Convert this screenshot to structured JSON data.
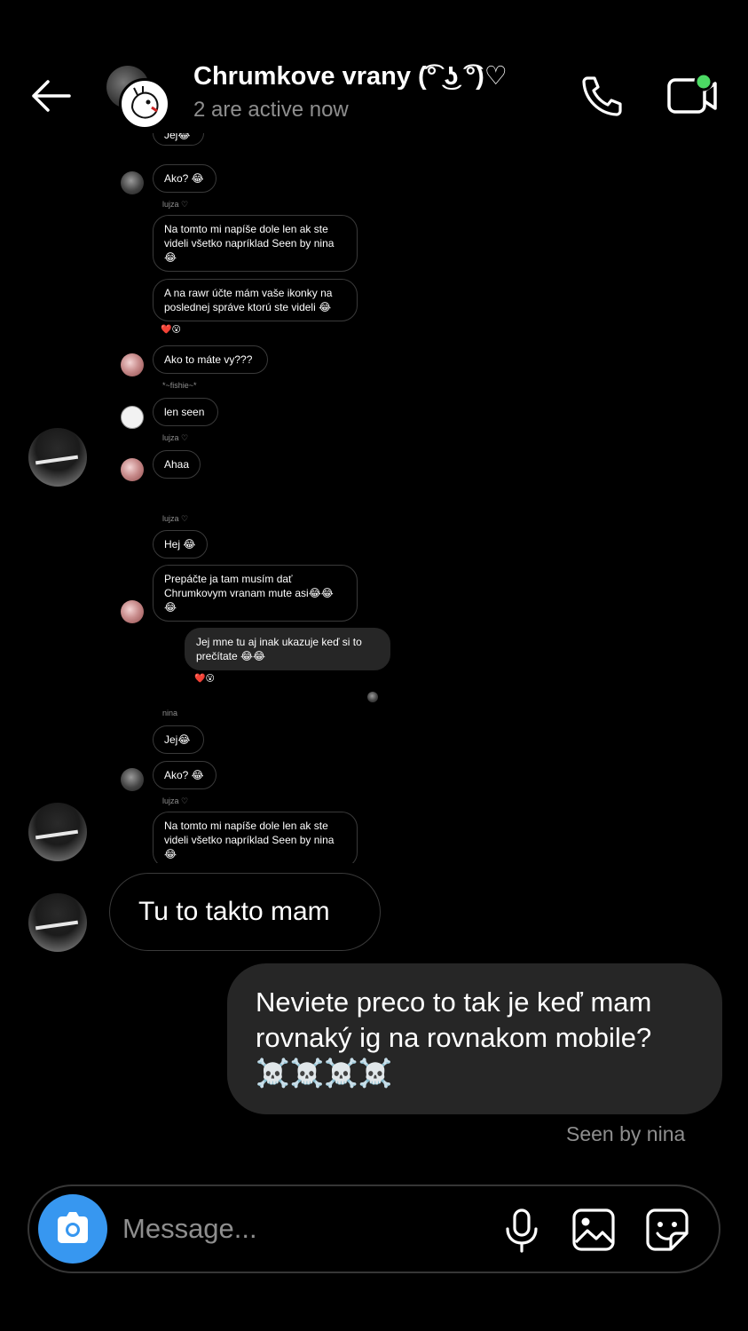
{
  "header": {
    "title": "Chrumkove vrany (͡° ͜ʖ ͡°)♡",
    "subtitle": "2 are active now"
  },
  "shared_screenshot": {
    "top_partial": "Jej😂",
    "msg_ako_1": "Ako? 😂",
    "name_lujza_1": "lujza ♡",
    "msg_natomto_1": "Na tomto mi napíše dole len ak ste videli všetko napríklad Seen by nina 😂",
    "msg_rawr": "A na rawr účte mám vaše ikonky na poslednej správe ktorú ste videli 😂",
    "react_1": "❤️😮",
    "msg_akomate": "Ako to máte vy???",
    "name_fishie": "*~fishie~*",
    "msg_lenseen": "len seen",
    "name_lujza_2": "lujza ♡",
    "msg_ahaa": "Ahaa",
    "name_lujza_3": "lujza ♡",
    "msg_hej": "Hej 😂",
    "msg_prepacte": "Prepáčte ja tam musím dať Chrumkovym vranam mute asi😂😂 😂",
    "msg_jejmne": "Jej mne tu aj inak ukazuje keď si to prečítate 😂😂",
    "react_2": "❤️😮",
    "name_nina": "nina",
    "msg_jej": "Jej😂",
    "msg_ako_2": "Ako? 😂",
    "name_lujza_4": "lujza ♡",
    "msg_natomto_2": "Na tomto mi napíše dole len ak ste videli všetko napríklad Seen by nina 😂"
  },
  "messages": {
    "received": "Tu to takto mam",
    "sent": "Neviete preco to tak je keď mam rovnaký ig na rovnakom mobile? ☠️☠️☠️☠️",
    "seen": "Seen by nina"
  },
  "composer": {
    "placeholder": "Message..."
  },
  "colors": {
    "background": "#000000",
    "sent_bubble": "#262626",
    "accent": "#3797f0",
    "active_dot": "#4cd964",
    "muted_text": "#8e8e8e"
  }
}
